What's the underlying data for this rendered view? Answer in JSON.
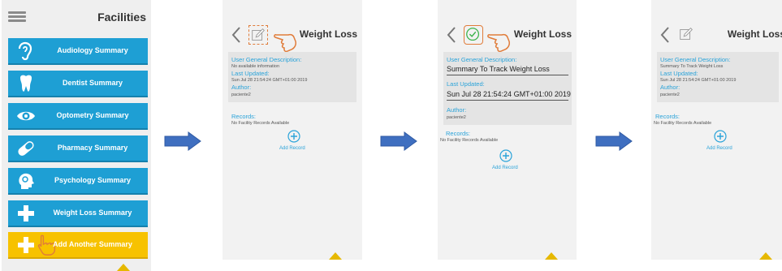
{
  "screen1": {
    "title": "Facilities",
    "items": [
      {
        "label": "Audiology Summary",
        "icon": "ear-icon"
      },
      {
        "label": "Dentist Summary",
        "icon": "tooth-icon"
      },
      {
        "label": "Optometry Summary",
        "icon": "eye-icon"
      },
      {
        "label": "Pharmacy Summary",
        "icon": "pill-icon"
      },
      {
        "label": "Psychology Summary",
        "icon": "head-icon"
      },
      {
        "label": "Weight Loss Summary",
        "icon": "plus-icon"
      },
      {
        "label": "Add Another Summary",
        "icon": "plus-icon"
      }
    ]
  },
  "screen2": {
    "title": "Weight Loss",
    "general_label": "User General Description:",
    "general_value": "No available information",
    "updated_label": "Last Updated:",
    "updated_value": "Sun Jul 28 21:54:24 GMT+01:00 2019",
    "author_label": "Author:",
    "author_value": "paciente2",
    "records_label": "Records:",
    "records_value": "No Facility Records Available",
    "add_label": "Add Record"
  },
  "screen3": {
    "title": "Weight Loss",
    "general_label": "User General Description:",
    "general_value": "Summary To Track Weight Loss",
    "updated_label": "Last Updated:",
    "updated_value": "Sun Jul 28 21:54:24 GMT+01:00 2019",
    "author_label": "Author:",
    "author_value": "paciente2",
    "records_label": "Records:",
    "records_value": "No Facility Records Available",
    "add_label": "Add Record"
  },
  "screen4": {
    "title": "Weight Loss",
    "general_label": "User General Description:",
    "general_value": "Summary To Track Weight Loss",
    "updated_label": "Last Updated:",
    "updated_value": "Sun Jul 28 21:54:24 GMT+01:00 2019",
    "author_label": "Author:",
    "author_value": "paciente2",
    "records_label": "Records:",
    "records_value": "No Facility Records Available",
    "add_label": "Add Record"
  },
  "colors": {
    "item_blue": "#1e9fd4",
    "item_yellow": "#f7c200",
    "label_blue": "#2aa3d9",
    "flow_arrow": "#3f6fc0",
    "pointer_orange": "#e07c3a"
  }
}
